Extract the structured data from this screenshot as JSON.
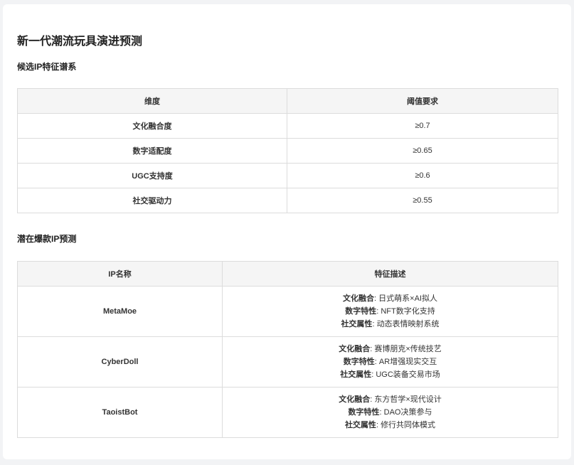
{
  "title": "新一代潮流玩具演进预测",
  "section1": {
    "heading": "候选IP特征谱系",
    "headers": [
      "维度",
      "阈值要求"
    ],
    "rows": [
      [
        "文化融合度",
        "≥0.7"
      ],
      [
        "数字适配度",
        "≥0.65"
      ],
      [
        "UGC支持度",
        "≥0.6"
      ],
      [
        "社交驱动力",
        "≥0.55"
      ]
    ]
  },
  "section2": {
    "heading": "潜在爆款IP预测",
    "headers": [
      "IP名称",
      "特征描述"
    ],
    "rows": [
      {
        "name": "MetaMoe",
        "features": [
          {
            "key": "文化融合",
            "sep": ": ",
            "value": "日式萌系×AI拟人"
          },
          {
            "key": "数字特性",
            "sep": ": ",
            "value": "NFT数字化支持"
          },
          {
            "key": "社交属性",
            "sep": ": ",
            "value": "动态表情映射系统"
          }
        ]
      },
      {
        "name": "CyberDoll",
        "features": [
          {
            "key": "文化融合",
            "sep": ": ",
            "value": "赛博朋克×传统技艺"
          },
          {
            "key": "数字特性",
            "sep": ": ",
            "value": "AR增强现实交互"
          },
          {
            "key": "社交属性",
            "sep": ": ",
            "value": "UGC装备交易市场"
          }
        ]
      },
      {
        "name": "TaoistBot",
        "features": [
          {
            "key": "文化融合",
            "sep": ": ",
            "value": "东方哲学×现代设计"
          },
          {
            "key": "数字特性",
            "sep": ": ",
            "value": "DAO决策参与"
          },
          {
            "key": "社交属性",
            "sep": ": ",
            "value": "修行共同体模式"
          }
        ]
      }
    ]
  }
}
